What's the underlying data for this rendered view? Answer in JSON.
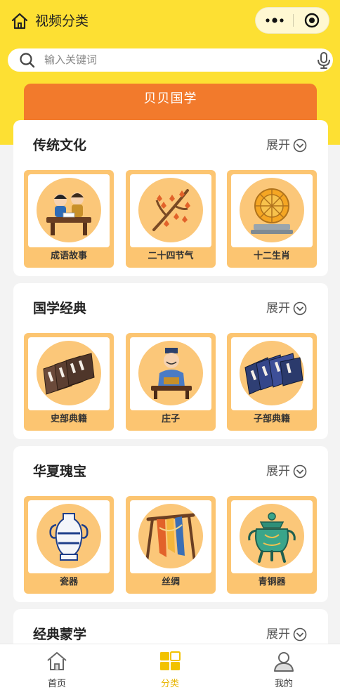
{
  "header": {
    "title": "视频分类",
    "home_icon": "home-icon",
    "capsule": {
      "more_icon": "more-dots-icon",
      "close_icon": "target-close-icon"
    }
  },
  "search": {
    "placeholder": "输入关键词",
    "search_icon": "search-icon",
    "mic_icon": "microphone-icon"
  },
  "banner": {
    "label": "贝贝国学"
  },
  "sections": [
    {
      "title": "传统文化",
      "expand_label": "展开",
      "items": [
        {
          "label": "成语故事",
          "icon": "storytellers-icon"
        },
        {
          "label": "二十四节气",
          "icon": "autumn-branch-icon"
        },
        {
          "label": "十二生肖",
          "icon": "zodiac-wheel-icon"
        }
      ]
    },
    {
      "title": "国学经典",
      "expand_label": "展开",
      "items": [
        {
          "label": "史部典籍",
          "icon": "history-books-icon"
        },
        {
          "label": "庄子",
          "icon": "scholar-reading-icon"
        },
        {
          "label": "子部典籍",
          "icon": "philosophy-books-icon"
        }
      ]
    },
    {
      "title": "华夏瑰宝",
      "expand_label": "展开",
      "items": [
        {
          "label": "瓷器",
          "icon": "porcelain-vase-icon"
        },
        {
          "label": "丝绸",
          "icon": "silk-rack-icon"
        },
        {
          "label": "青铜器",
          "icon": "bronze-ding-icon"
        }
      ]
    },
    {
      "title": "经典蒙学",
      "expand_label": "展开",
      "items": []
    }
  ],
  "tabbar": {
    "items": [
      {
        "label": "首页",
        "icon": "home-tab-icon"
      },
      {
        "label": "分类",
        "icon": "category-tab-icon",
        "active": true
      },
      {
        "label": "我的",
        "icon": "profile-tab-icon"
      }
    ]
  },
  "colors": {
    "header_yellow": "#fde033",
    "banner_orange": "#f27a2c",
    "tile_orange": "#fcc571",
    "circle_orange": "#fbc779",
    "active_tab": "#e8b400",
    "page_bg": "#f3f3f3"
  }
}
